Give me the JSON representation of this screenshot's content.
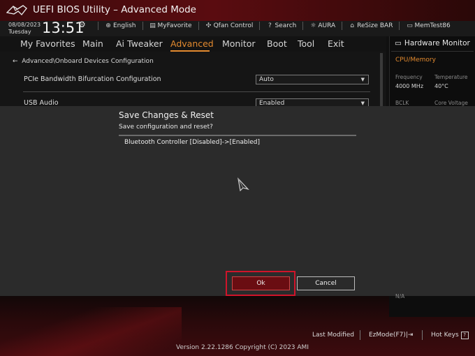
{
  "window": {
    "title": "UEFI BIOS Utility – Advanced Mode"
  },
  "clock": {
    "date": "08/08/2023",
    "day": "Tuesday",
    "time": "13:51"
  },
  "toolbar": {
    "items": [
      {
        "label": "English"
      },
      {
        "label": "MyFavorite"
      },
      {
        "label": "Qfan Control"
      },
      {
        "label": "Search"
      },
      {
        "label": "AURA"
      },
      {
        "label": "ReSize BAR"
      },
      {
        "label": "MemTest86"
      }
    ]
  },
  "nav": {
    "tabs": [
      {
        "label": "My Favorites"
      },
      {
        "label": "Main"
      },
      {
        "label": "Ai Tweaker"
      },
      {
        "label": "Advanced",
        "active": true
      },
      {
        "label": "Monitor"
      },
      {
        "label": "Boot"
      },
      {
        "label": "Tool"
      },
      {
        "label": "Exit"
      }
    ]
  },
  "content": {
    "breadcrumb": "Advanced\\Onboard Devices Configuration",
    "settings": [
      {
        "label": "PCIe Bandwidth Bifurcation Configuration",
        "value": "Auto"
      },
      {
        "label": "USB Audio",
        "value": "Enabled"
      }
    ]
  },
  "hardware_monitor": {
    "title": "Hardware Monitor",
    "section": "CPU/Memory",
    "frequency_label": "Frequency",
    "frequency_value": "4000 MHz",
    "temperature_label": "Temperature",
    "temperature_value": "40°C",
    "bclk_label": "BCLK",
    "core_voltage_label": "Core Voltage",
    "na_value": "N/A"
  },
  "dialog": {
    "title": "Save Changes & Reset",
    "subtitle": "Save configuration and reset?",
    "changes": [
      "Bluetooth Controller [Disabled]->[Enabled]"
    ],
    "ok_label": "Ok",
    "cancel_label": "Cancel"
  },
  "footer": {
    "last_modified": "Last Modified",
    "ezmode": "EzMode(F7)",
    "hotkeys": "Hot Keys",
    "version": "Version 2.22.1286 Copyright (C) 2023 AMI"
  },
  "colors": {
    "accent": "#e38a2f",
    "brand_red": "#d0142a",
    "background": "#101010"
  },
  "icons": [
    "rog-logo",
    "gear-icon",
    "globe-icon",
    "favorite-icon",
    "fan-icon",
    "search-icon",
    "aura-icon",
    "resize-bar-icon",
    "memtest-icon",
    "back-arrow-icon",
    "monitor-icon",
    "question-icon",
    "exit-icon",
    "mouse-cursor-icon"
  ]
}
